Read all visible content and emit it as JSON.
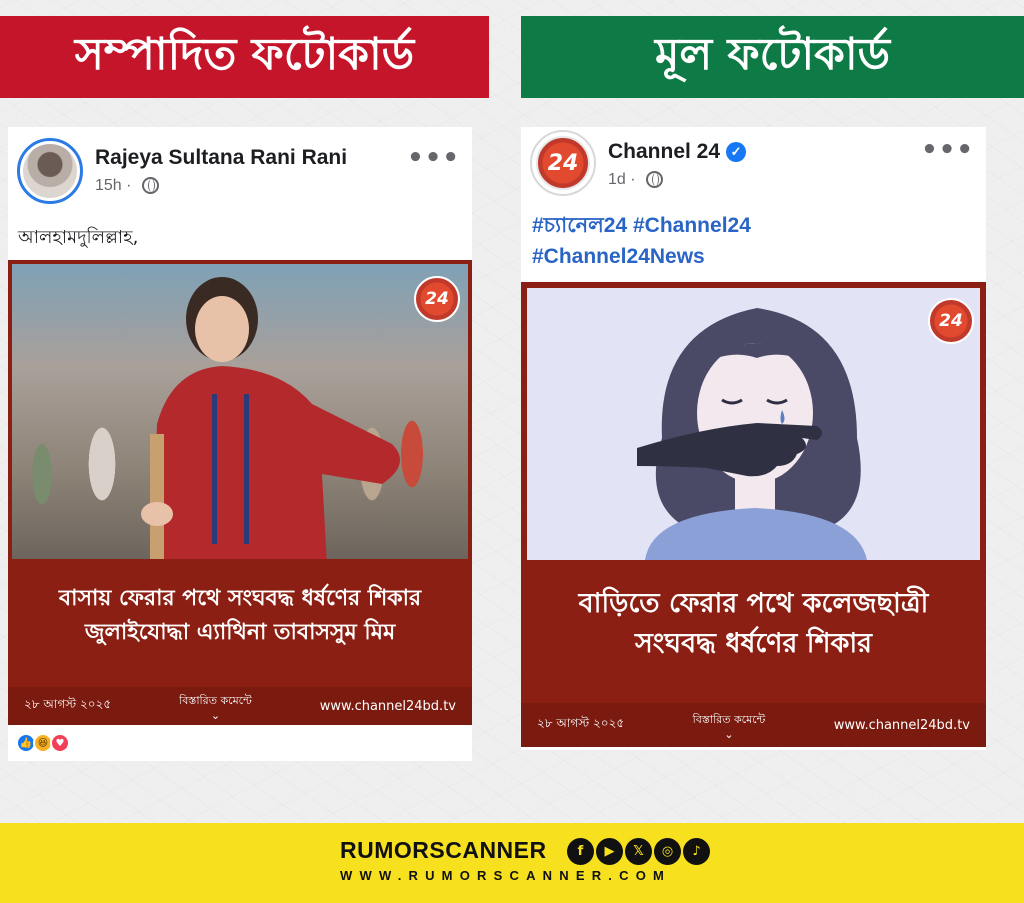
{
  "banners": {
    "left_title": "সম্পাদিত ফটোকার্ড",
    "right_title": "মূল ফটোকার্ড"
  },
  "left_post": {
    "author": "Rajeya Sultana Rani Rani",
    "time": "15h",
    "separator": "·",
    "more": "•••",
    "caption": "আলহামদুলিল্লাহ,",
    "card": {
      "logo": "24",
      "headline_line1": "বাসায় ফেরার পথে সংঘবদ্ধ ধর্ষণের শিকার",
      "headline_line2": "জুলাইযোদ্ধা এ্যাথিনা তাবাসসুম মিম",
      "date": "২৮ আগস্ট ২০২৫",
      "details": "বিস্তারিত কমেন্টে",
      "site": "www.channel24bd.tv"
    },
    "reactions": [
      "like",
      "haha",
      "love"
    ]
  },
  "right_post": {
    "author": "Channel 24",
    "time": "1d",
    "separator": "·",
    "more": "•••",
    "hashtags_line1": "#চ্যানেল24 #Channel24",
    "hashtags_line2": "#Channel24News",
    "card": {
      "logo": "24",
      "headline_line1": "বাড়িতে ফেরার পথে কলেজছাত্রী",
      "headline_line2": "সংঘবদ্ধ ধর্ষণের শিকার",
      "date": "২৮ আগস্ট ২০২৫",
      "details": "বিস্তারিত কমেন্টে",
      "site": "www.channel24bd.tv"
    }
  },
  "footer": {
    "brand": "RUMORSCANNER",
    "website": "WWW.RUMORSCANNER.COM",
    "social_icons": [
      "facebook-icon",
      "youtube-icon",
      "x-icon",
      "instagram-icon",
      "tiktok-icon"
    ]
  },
  "colors": {
    "left_banner": "#c4152a",
    "right_banner": "#0e7a45",
    "card_red": "#8c1f13",
    "hashtag_blue": "#2a64c5",
    "footer_yellow": "#f7e01e"
  }
}
